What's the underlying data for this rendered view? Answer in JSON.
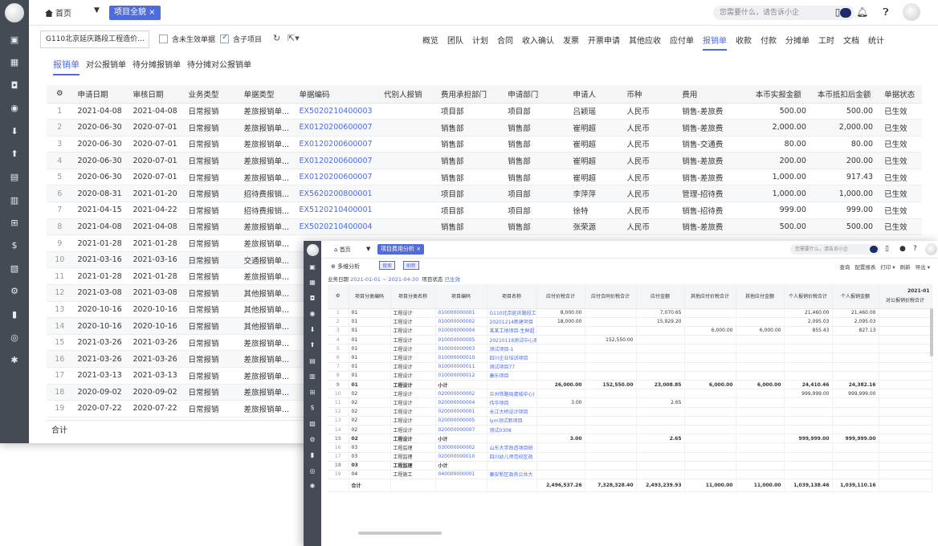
{
  "back": {
    "topbar": {
      "home_label": "首页",
      "active_tab": "项目全貌 ×",
      "search_placeholder": "您需要什么，请告诉小企"
    },
    "toolbar": {
      "project_select": "G110北京延庆路段工程造价…",
      "checkbox_unsigned": "含未生效单据",
      "checkbox_sub": "含子项目",
      "nav": [
        "概览",
        "团队",
        "计划",
        "合同",
        "收入确认",
        "发票",
        "开票申请",
        "其他应收",
        "应付单",
        "报销单",
        "收款",
        "付款",
        "分摊单",
        "工时",
        "文档",
        "统计"
      ],
      "nav_active_index": 9
    },
    "subtabs": [
      "报销单",
      "对公报销单",
      "待分摊报销单",
      "待分摊对公报销单"
    ],
    "table": {
      "headers": [
        "申请日期",
        "审核日期",
        "业务类型",
        "单据类型",
        "单据编码",
        "代别人报销",
        "费用承担部门",
        "申请部门",
        "申请人",
        "币种",
        "费用",
        "本币实报金额",
        "本币抵扣后金额",
        "单据状态"
      ],
      "rows": [
        [
          "1",
          "2021-04-08",
          "2021-04-08",
          "日常报销",
          "差旅报销单...",
          "EX5020210400003",
          "",
          "项目部",
          "项目部",
          "吕颖瑶",
          "人民币",
          "销售-差旅费",
          "500.00",
          "500.00",
          "已生效"
        ],
        [
          "2",
          "2020-06-30",
          "2020-07-01",
          "日常报销",
          "差旅报销单...",
          "EX0120200600007",
          "",
          "销售部",
          "销售部",
          "崔明超",
          "人民币",
          "销售-差旅费",
          "2,000.00",
          "2,000.00",
          "已生效"
        ],
        [
          "3",
          "2020-06-30",
          "2020-07-01",
          "日常报销",
          "差旅报销单...",
          "EX0120200600007",
          "",
          "销售部",
          "销售部",
          "崔明超",
          "人民币",
          "销售-交通费",
          "80.00",
          "80.00",
          "已生效"
        ],
        [
          "4",
          "2020-06-30",
          "2020-07-01",
          "日常报销",
          "差旅报销单...",
          "EX0120200600007",
          "",
          "销售部",
          "销售部",
          "崔明超",
          "人民币",
          "销售-差旅费",
          "200.00",
          "200.00",
          "已生效"
        ],
        [
          "5",
          "2020-06-30",
          "2020-07-01",
          "日常报销",
          "差旅报销单...",
          "EX0120200600007",
          "",
          "销售部",
          "销售部",
          "崔明超",
          "人民币",
          "销售-差旅费",
          "1,000.00",
          "917.43",
          "已生效"
        ],
        [
          "6",
          "2020-08-31",
          "2021-01-20",
          "日常报销",
          "招待费报销...",
          "EX5620200800001",
          "",
          "项目部",
          "项目部",
          "李萍萍",
          "人民币",
          "管理-招待费",
          "1,000.00",
          "1,000.00",
          "已生效"
        ],
        [
          "7",
          "2021-04-15",
          "2021-04-22",
          "日常报销",
          "招待费报销...",
          "EX5120210400001",
          "",
          "项目部",
          "项目部",
          "徐特",
          "人民币",
          "销售-招待费",
          "999.00",
          "999.00",
          "已生效"
        ],
        [
          "8",
          "2021-04-08",
          "2021-04-08",
          "日常报销",
          "差旅报销单...",
          "EX5020210400004",
          "",
          "销售部",
          "销售部",
          "张荣源",
          "人民币",
          "销售-差旅费",
          "500.00",
          "500.00",
          "已生效"
        ],
        [
          "9",
          "2021-01-28",
          "2021-01-28",
          "日常报销",
          "差旅报销单...",
          "",
          "",
          "",
          "",
          "",
          "",
          "",
          "",
          "",
          ""
        ],
        [
          "10",
          "2021-03-16",
          "2021-03-16",
          "日常报销",
          "交通报销单...",
          "",
          "",
          "",
          "",
          "",
          "",
          "",
          "",
          "",
          ""
        ],
        [
          "11",
          "2021-01-28",
          "2021-01-28",
          "日常报销",
          "差旅报销单...",
          "",
          "",
          "",
          "",
          "",
          "",
          "",
          "",
          "",
          ""
        ],
        [
          "12",
          "2021-03-08",
          "2021-03-08",
          "日常报销",
          "其他报销单...",
          "",
          "",
          "",
          "",
          "",
          "",
          "",
          "",
          "",
          ""
        ],
        [
          "13",
          "2020-10-16",
          "2020-10-16",
          "日常报销",
          "其他报销单...",
          "",
          "",
          "",
          "",
          "",
          "",
          "",
          "",
          "",
          ""
        ],
        [
          "14",
          "2020-10-16",
          "2020-10-16",
          "日常报销",
          "其他报销单...",
          "",
          "",
          "",
          "",
          "",
          "",
          "",
          "",
          "",
          ""
        ],
        [
          "15",
          "2021-03-26",
          "2021-03-26",
          "日常报销",
          "差旅报销单...",
          "",
          "",
          "",
          "",
          "",
          "",
          "",
          "",
          "",
          ""
        ],
        [
          "16",
          "2021-03-26",
          "2021-03-26",
          "日常报销",
          "差旅报销单...",
          "",
          "",
          "",
          "",
          "",
          "",
          "",
          "",
          "",
          ""
        ],
        [
          "17",
          "2021-03-13",
          "2021-03-13",
          "日常报销",
          "差旅报销单...",
          "",
          "",
          "",
          "",
          "",
          "",
          "",
          "",
          "",
          ""
        ],
        [
          "18",
          "2020-09-02",
          "2020-09-02",
          "日常报销",
          "差旅报销单...",
          "",
          "",
          "",
          "",
          "",
          "",
          "",
          "",
          "",
          ""
        ],
        [
          "19",
          "2020-07-22",
          "2020-07-22",
          "日常报销",
          "差旅报销单...",
          "",
          "",
          "",
          "",
          "",
          "",
          "",
          "",
          "",
          ""
        ]
      ],
      "footer": "合计"
    }
  },
  "front": {
    "topbar": {
      "home_label": "首页",
      "active_tab": "项目费用分析 ×",
      "search_placeholder": "您需要什么，请告诉小企"
    },
    "tools": {
      "multi_dim": "多维分析",
      "btn_search": "搜索",
      "btn_refresh": "刷新",
      "right": [
        "查询",
        "配置报表",
        "打印 ▾",
        "刷新",
        "导出 ▾"
      ]
    },
    "filter": {
      "date_label": "业务日期",
      "date_value": "2021-01-01 ~ 2021-04-30",
      "status_label": "项目状态",
      "status_value": "已生效"
    },
    "table": {
      "period": "2021-01",
      "headers": [
        "项目分类编码",
        "项目分类名称",
        "项目编码",
        "项目名称",
        "应付价税合计",
        "应付合同价税合计",
        "应付金额",
        "其他应付价税合计",
        "其他应付金额",
        "个人报销价税合计",
        "个人报销金额",
        "对公报销价税合计"
      ],
      "rows": [
        {
          "i": "1",
          "c1": "01",
          "c2": "工程设计",
          "c3": "010000000001",
          "c4": "G110北京延庆路段工",
          "v": [
            "8,000.00",
            "",
            "7,070.65",
            "",
            "",
            "21,460.00",
            "21,460.00",
            ""
          ]
        },
        {
          "i": "2",
          "c1": "01",
          "c2": "工程设计",
          "c3": "010000000002",
          "c4": "20201214新建项目",
          "v": [
            "18,000.00",
            "",
            "15,929.20",
            "",
            "",
            "2,095.03",
            "2,095.03",
            ""
          ]
        },
        {
          "i": "3",
          "c1": "01",
          "c2": "工程设计",
          "c3": "010000000004",
          "c4": "某某工地项目-生鲜超",
          "v": [
            "",
            "",
            "",
            "6,000.00",
            "6,000.00",
            "855.43",
            "827.13",
            ""
          ]
        },
        {
          "i": "4",
          "c1": "01",
          "c2": "工程设计",
          "c3": "010000000005",
          "c4": "20210118测试中心测",
          "v": [
            "",
            "152,550.00",
            "",
            "",
            "",
            "",
            "",
            ""
          ]
        },
        {
          "i": "5",
          "c1": "01",
          "c2": "工程设计",
          "c3": "010000000003",
          "c4": "测试项目-1",
          "v": [
            "",
            "",
            "",
            "",
            "",
            "",
            "",
            ""
          ]
        },
        {
          "i": "6",
          "c1": "01",
          "c2": "工程设计",
          "c3": "010000000010",
          "c4": "四川企业培训项目",
          "v": [
            "",
            "",
            "",
            "",
            "",
            "",
            "",
            ""
          ]
        },
        {
          "i": "7",
          "c1": "01",
          "c2": "工程设计",
          "c3": "010000000011",
          "c4": "测试项目77",
          "v": [
            "",
            "",
            "",
            "",
            "",
            "",
            "",
            ""
          ]
        },
        {
          "i": "8",
          "c1": "01",
          "c2": "工程设计",
          "c3": "010000000012",
          "c4": "康乐项目",
          "v": [
            "",
            "",
            "",
            "",
            "",
            "",
            "",
            ""
          ]
        },
        {
          "i": "9",
          "c1": "01",
          "c2": "工程设计",
          "c3": "小计",
          "c4": "",
          "v": [
            "26,000.00",
            "152,550.00",
            "23,008.85",
            "6,000.00",
            "6,000.00",
            "24,410.46",
            "24,382.16",
            ""
          ],
          "sub": true
        },
        {
          "i": "10",
          "c1": "02",
          "c2": "工程设计",
          "c3": "020000000002",
          "c4": "兰州铁路局虞城中心(",
          "v": [
            "",
            "",
            "",
            "",
            "",
            "999,999.00",
            "999,999.00",
            ""
          ]
        },
        {
          "i": "11",
          "c1": "02",
          "c2": "工程设计",
          "c3": "020000000004",
          "c4": "伟华项目",
          "v": [
            "3.00",
            "",
            "2.65",
            "",
            "",
            "",
            "",
            ""
          ]
        },
        {
          "i": "12",
          "c1": "02",
          "c2": "工程设计",
          "c3": "020000000001",
          "c4": "长江大桥设计项目",
          "v": [
            "",
            "",
            "",
            "",
            "",
            "",
            "",
            ""
          ]
        },
        {
          "i": "13",
          "c1": "02",
          "c2": "工程设计",
          "c3": "020000000005",
          "c4": "lym测试新项目",
          "v": [
            "",
            "",
            "",
            "",
            "",
            "",
            "",
            ""
          ]
        },
        {
          "i": "14",
          "c1": "02",
          "c2": "工程设计",
          "c3": "020000000007",
          "c4": "测试0308",
          "v": [
            "",
            "",
            "",
            "",
            "",
            "",
            "",
            ""
          ]
        },
        {
          "i": "15",
          "c1": "02",
          "c2": "工程设计",
          "c3": "小计",
          "c4": "",
          "v": [
            "3.00",
            "",
            "2.65",
            "",
            "",
            "999,999.00",
            "999,999.00",
            ""
          ],
          "sub": true
        },
        {
          "i": "16",
          "c1": "03",
          "c2": "工程监理",
          "c3": "030000000002",
          "c4": "山东大学改造项目研",
          "v": [
            "",
            "",
            "",
            "",
            "",
            "",
            "",
            ""
          ]
        },
        {
          "i": "17",
          "c1": "03",
          "c2": "工程监理",
          "c3": "020000000010",
          "c4": "四川幼儿师范校区改",
          "v": [
            "",
            "",
            "",
            "",
            "",
            "",
            "",
            ""
          ]
        },
        {
          "i": "18",
          "c1": "03",
          "c2": "工程监理",
          "c3": "小计",
          "c4": "",
          "v": [
            "",
            "",
            "",
            "",
            "",
            "",
            "",
            ""
          ],
          "sub": true
        },
        {
          "i": "19",
          "c1": "04",
          "c2": "工程施工",
          "c3": "040000000001",
          "c4": "康安新区政务公共大",
          "v": [
            "",
            "",
            "",
            "",
            "",
            "",
            "",
            ""
          ]
        }
      ],
      "footer_label": "合计",
      "footer_values": [
        "2,496,537.26",
        "7,328,328.40",
        "2,493,239.93",
        "11,000.00",
        "11,000.00",
        "1,039,138.46",
        "1,039,110.16"
      ]
    }
  },
  "colors": {
    "accent": "#4f6bdc",
    "sidebar": "#444b55"
  }
}
